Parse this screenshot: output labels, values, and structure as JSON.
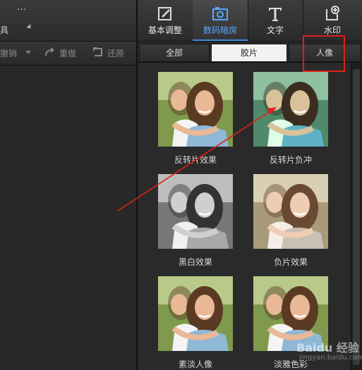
{
  "left_topbar": {
    "menu_dots": "···",
    "partial_label": "具"
  },
  "left_toolbar": {
    "undo_label": "撤销",
    "redo_label": "重做",
    "restore_label": "还原"
  },
  "top_tabs": [
    {
      "label": "基本调整",
      "icon": "edit-icon"
    },
    {
      "label": "数码暗房",
      "icon": "camera-icon",
      "active": true
    },
    {
      "label": "文字",
      "icon": "text-icon"
    },
    {
      "label": "水印",
      "icon": "watermark-icon"
    }
  ],
  "sub_tabs": [
    {
      "label": "全部"
    },
    {
      "label": "胶片",
      "active": true
    },
    {
      "label": "人像"
    }
  ],
  "effects": [
    {
      "label": "反转片效果",
      "filter": "normal"
    },
    {
      "label": "反转片负冲",
      "filter": "cross"
    },
    {
      "label": "黑白效果",
      "filter": "bw"
    },
    {
      "label": "负片效果",
      "filter": "faded"
    },
    {
      "label": "素淡人像",
      "filter": "normal"
    },
    {
      "label": "淡雅色彩",
      "filter": "normal"
    }
  ],
  "colors": {
    "accent": "#3b8be0",
    "highlight_box": "#e0201a",
    "arrow": "#e0201a"
  },
  "watermark": {
    "text": "Baidu 经验",
    "url": "jingyan.baidu.com"
  }
}
